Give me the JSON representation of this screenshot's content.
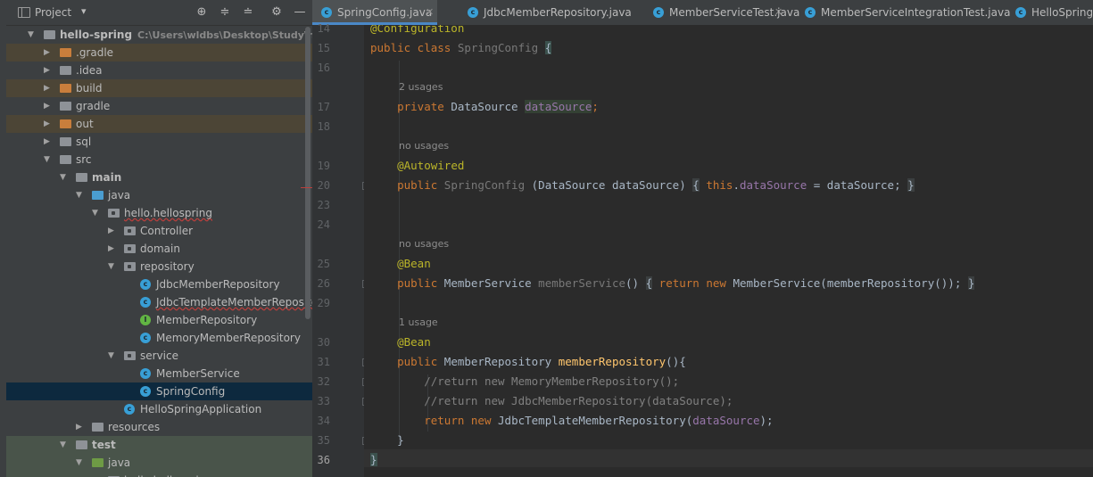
{
  "project_panel": {
    "title": "Project",
    "tree": [
      {
        "label": "hello-spring",
        "path": "C:\\Users\\wldbs\\Desktop\\Study\\hello-s",
        "icon": "module-folder-icon",
        "expanded": true,
        "depth": 0
      },
      {
        "label": ".gradle",
        "icon": "folder-orange-icon",
        "expanded": false,
        "depth": 1
      },
      {
        "label": ".idea",
        "icon": "folder-icon",
        "expanded": false,
        "depth": 1
      },
      {
        "label": "build",
        "icon": "folder-orange-icon",
        "expanded": false,
        "depth": 1
      },
      {
        "label": "gradle",
        "icon": "folder-icon",
        "expanded": false,
        "depth": 1
      },
      {
        "label": "out",
        "icon": "folder-orange-icon",
        "expanded": false,
        "depth": 1
      },
      {
        "label": "sql",
        "icon": "folder-icon",
        "expanded": false,
        "depth": 1
      },
      {
        "label": "src",
        "icon": "folder-icon",
        "expanded": true,
        "depth": 1
      },
      {
        "label": "main",
        "icon": "folder-icon",
        "expanded": true,
        "depth": 2
      },
      {
        "label": "java",
        "icon": "source-folder-icon",
        "expanded": true,
        "depth": 3
      },
      {
        "label": "hello.hellospring",
        "icon": "package-icon",
        "expanded": true,
        "depth": 4
      },
      {
        "label": "Controller",
        "icon": "package-icon",
        "expanded": false,
        "depth": 5
      },
      {
        "label": "domain",
        "icon": "package-icon",
        "expanded": false,
        "depth": 5
      },
      {
        "label": "repository",
        "icon": "package-icon",
        "expanded": true,
        "depth": 5
      },
      {
        "label": "JdbcMemberRepository",
        "icon": "class-icon",
        "depth": 6
      },
      {
        "label": "JdbcTemplateMemberRepository",
        "icon": "class-icon",
        "depth": 6
      },
      {
        "label": "MemberRepository",
        "icon": "interface-icon",
        "depth": 6
      },
      {
        "label": "MemoryMemberRepository",
        "icon": "class-icon",
        "depth": 6
      },
      {
        "label": "service",
        "icon": "package-icon",
        "expanded": true,
        "depth": 5
      },
      {
        "label": "MemberService",
        "icon": "class-icon",
        "depth": 6
      },
      {
        "label": "SpringConfig",
        "icon": "class-icon",
        "depth": 6
      },
      {
        "label": "HelloSpringApplication",
        "icon": "spring-class-icon",
        "depth": 5
      },
      {
        "label": "resources",
        "icon": "resources-folder-icon",
        "expanded": false,
        "depth": 3
      },
      {
        "label": "test",
        "icon": "folder-icon",
        "expanded": true,
        "depth": 2
      },
      {
        "label": "java",
        "icon": "test-folder-icon",
        "expanded": true,
        "depth": 3
      },
      {
        "label": "hello.hellospring",
        "icon": "package-icon",
        "depth": 4
      }
    ]
  },
  "tabs": [
    {
      "label": "SpringConfig.java",
      "active": true
    },
    {
      "label": "JdbcMemberRepository.java",
      "active": false
    },
    {
      "label": "MemberServiceTest.java",
      "active": false
    },
    {
      "label": "MemberServiceIntegrationTest.java",
      "active": false
    },
    {
      "label": "HelloSpringA",
      "active": false
    }
  ],
  "editor": {
    "line_numbers": [
      "14",
      "15",
      "16",
      "17",
      "18",
      "19",
      "20",
      "23",
      "24",
      "25",
      "26",
      "29",
      "30",
      "31",
      "32",
      "33",
      "34",
      "35",
      "36"
    ],
    "current_line": "36",
    "hints": {
      "h1": "2 usages",
      "h2": "no usages",
      "h3": "no usages",
      "h4": "1 usage"
    },
    "code": {
      "l14_ann": "@Configuration",
      "l15_kw": "public class",
      "l15_name": "SpringConfig",
      "l15_brace": "{",
      "l17_kw": "private",
      "l17_type": "DataSource",
      "l17_field": "dataSource",
      "l17_semi": ";",
      "l19_ann": "@Autowired",
      "l20_kw": "public",
      "l20_name": "SpringConfig",
      "l20_params": "(DataSource dataSource)",
      "l20_open": "{",
      "l20_this": "this",
      "l20_dot": ".",
      "l20_field": "dataSource",
      "l20_assign": " = dataSource;",
      "l20_close": "}",
      "l25_ann": "@Bean",
      "l26_kw": "public",
      "l26_type": "MemberService",
      "l26_name": "memberService",
      "l26_parens": "()",
      "l26_open": "{",
      "l26_ret": "return",
      "l26_new": "new",
      "l26_call": "MemberService(memberRepository());",
      "l26_close": "}",
      "l30_ann": "@Bean",
      "l31_kw": "public",
      "l31_type": "MemberRepository",
      "l31_name": "memberRepository",
      "l31_rest": "(){",
      "l32_cmt": "//return new MemoryMemberRepository();",
      "l33_cmt": "//return new JdbcMemberRepository(dataSource);",
      "l34_ret": "return",
      "l34_new": "new",
      "l34_call": "JdbcTemplateMemberRepository(",
      "l34_field": "dataSource",
      "l34_end": ");",
      "l35": "}",
      "l36": "}"
    }
  }
}
